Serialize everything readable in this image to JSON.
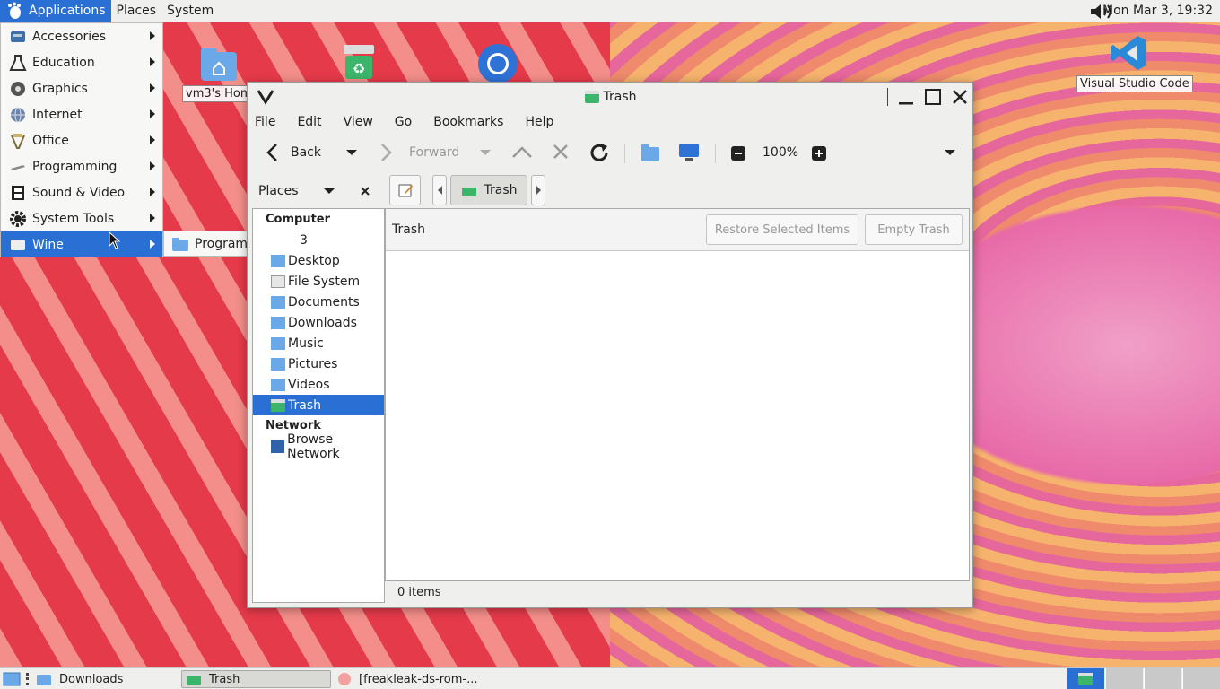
{
  "top_panel": {
    "menus": [
      "Applications",
      "Places",
      "System"
    ],
    "clock": "Mon Mar  3, 19:32",
    "volume_icon": "volume-icon"
  },
  "app_menu": {
    "items": [
      {
        "label": "Accessories",
        "icon": "accessories-icon"
      },
      {
        "label": "Education",
        "icon": "flask-icon"
      },
      {
        "label": "Graphics",
        "icon": "graphics-icon"
      },
      {
        "label": "Internet",
        "icon": "globe-icon"
      },
      {
        "label": "Office",
        "icon": "office-icon"
      },
      {
        "label": "Programming",
        "icon": "programming-icon"
      },
      {
        "label": "Sound & Video",
        "icon": "film-icon"
      },
      {
        "label": "System Tools",
        "icon": "gear-icon"
      },
      {
        "label": "Wine",
        "icon": "wine-icon"
      }
    ],
    "submenu": {
      "label": "Programs"
    }
  },
  "desktop": {
    "home_label": "vm3's Hom",
    "vscode_label": "Visual Studio Code"
  },
  "window": {
    "title": "Trash",
    "menubar": [
      "File",
      "Edit",
      "View",
      "Go",
      "Bookmarks",
      "Help"
    ],
    "toolbar": {
      "back": "Back",
      "forward": "Forward",
      "zoom": "100%"
    },
    "places_label": "Places",
    "breadcrumb": "Trash",
    "sidebar": {
      "computer_header": "Computer",
      "computer_items": [
        {
          "label": "3"
        },
        {
          "label": "Desktop"
        },
        {
          "label": "File System"
        },
        {
          "label": "Documents"
        },
        {
          "label": "Downloads"
        },
        {
          "label": "Music"
        },
        {
          "label": "Pictures"
        },
        {
          "label": "Videos"
        },
        {
          "label": "Trash"
        }
      ],
      "network_header": "Network",
      "network_items": [
        {
          "label": "Browse Network"
        }
      ]
    },
    "info_bar": {
      "label": "Trash",
      "restore_button": "Restore Selected Items",
      "empty_button": "Empty Trash"
    },
    "status": "0 items"
  },
  "bottom_panel": {
    "tasks": [
      {
        "label": "Downloads"
      },
      {
        "label": "Trash"
      },
      {
        "label": "[freakleak-ds-rom-..."
      }
    ]
  },
  "colors": {
    "accent": "#2a6fd4",
    "panel": "#efefed"
  }
}
